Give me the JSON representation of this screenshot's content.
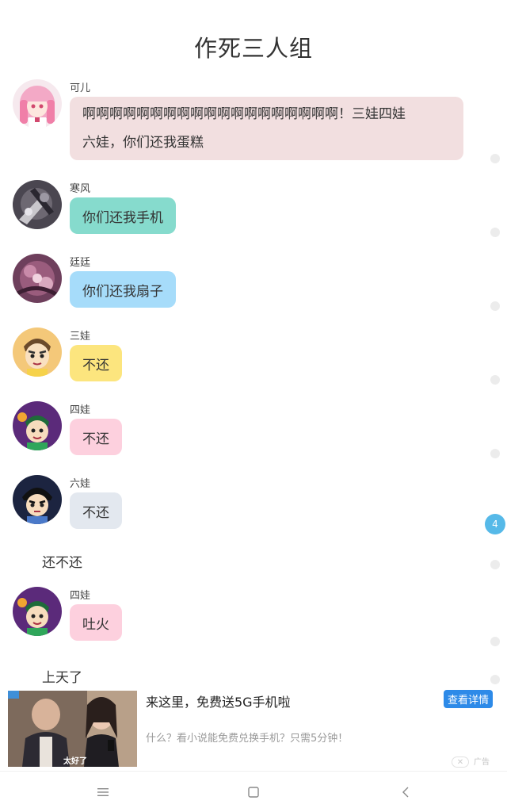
{
  "header": {
    "title": "作死三人组"
  },
  "messages": [
    {
      "sender": "可儿",
      "text": "啊啊啊啊啊啊啊啊啊啊啊啊啊啊啊啊啊啊啊！三娃四娃",
      "text2": "六娃，你们还我蛋糕",
      "color": "#f2dfe0"
    },
    {
      "sender": "寒风",
      "text": "你们还我手机",
      "color": "#86dbcd"
    },
    {
      "sender": "廷廷",
      "text": "你们还我扇子",
      "color": "#a6dcfa"
    },
    {
      "sender": "三娃",
      "text": "不还",
      "color": "#fce57e"
    },
    {
      "sender": "四娃",
      "text": "不还",
      "color": "#fdd0de"
    },
    {
      "sender": "六娃",
      "text": "不还",
      "color": "#e3e8ef"
    },
    {
      "sender": "四娃",
      "text": "吐火",
      "color": "#fdd0de"
    }
  ],
  "narration": [
    "还不还",
    "上天了"
  ],
  "side_badge": "4",
  "ad": {
    "headline": "来这里，免费送5G手机啦",
    "cta": "查看详情",
    "description": "什么？看小说能免费兑换手机？只需5分钟！",
    "image_caption": "太好了",
    "close": "✕",
    "label": "广告"
  },
  "nav": {
    "menu_glyph": "≡",
    "home_glyph": "▢",
    "back_glyph": "‹"
  }
}
